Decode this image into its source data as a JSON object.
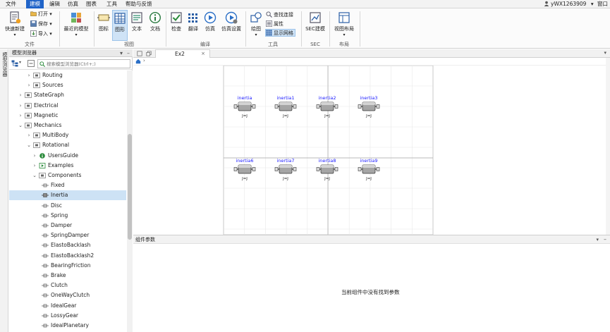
{
  "menubar": {
    "items": [
      "文件",
      "建模",
      "编辑",
      "仿真",
      "图表",
      "工具",
      "帮助与反馈"
    ],
    "active_index": 1,
    "user": "yWX1263909",
    "window_menu": "窗口"
  },
  "ribbon": {
    "file_group": {
      "quick_new": "快速新建",
      "open": "打开",
      "save": "保存",
      "import": "导入",
      "label": "文件"
    },
    "recent_models": "最近的模型",
    "view_group": {
      "icon_view": "图标",
      "diagram_view": "图形",
      "text_view": "文本",
      "doc_view": "文档",
      "label": "视图"
    },
    "compile_group": {
      "check": "检查",
      "translate": "翻译",
      "simulate": "仿真",
      "sim_settings": "仿真设置",
      "label": "编译"
    },
    "tools_group": {
      "draw": "绘图",
      "find_connection": "查找连接",
      "properties": "属性",
      "show_grid": "显示网格",
      "label": "工具"
    },
    "sec_group": {
      "sec_build": "SEC建模",
      "label": "SEC"
    },
    "layout_group": {
      "view_layout": "视图布局",
      "label": "布局"
    }
  },
  "side_strip": {
    "label": "模型浏览器"
  },
  "browser": {
    "title": "模型浏览器",
    "search_placeholder": "搜索模型浏览器(Ctrl+;)",
    "tree": [
      {
        "label": "Routing",
        "level": 2,
        "arrow": ">",
        "icon": "routing-icon"
      },
      {
        "label": "Sources",
        "level": 2,
        "arrow": ">",
        "icon": "sources-icon"
      },
      {
        "label": "StateGraph",
        "level": 1,
        "arrow": ">",
        "icon": "stategraph-icon"
      },
      {
        "label": "Electrical",
        "level": 1,
        "arrow": ">",
        "icon": "electrical-icon"
      },
      {
        "label": "Magnetic",
        "level": 1,
        "arrow": ">",
        "icon": "magnetic-icon"
      },
      {
        "label": "Mechanics",
        "level": 1,
        "arrow": "v",
        "icon": "mechanics-icon"
      },
      {
        "label": "MultiBody",
        "level": 2,
        "arrow": ">",
        "icon": "multibody-icon"
      },
      {
        "label": "Rotational",
        "level": 2,
        "arrow": "v",
        "icon": "rotational-icon"
      },
      {
        "label": "UsersGuide",
        "level": 3,
        "arrow": ">",
        "icon": "info-icon"
      },
      {
        "label": "Examples",
        "level": 3,
        "arrow": ">",
        "icon": "play-icon"
      },
      {
        "label": "Components",
        "level": 3,
        "arrow": "v",
        "icon": "components-icon"
      },
      {
        "label": "Fixed",
        "level": 4,
        "arrow": "",
        "icon": "fixed-icon"
      },
      {
        "label": "Inertia",
        "level": 4,
        "arrow": "",
        "icon": "inertia-icon",
        "selected": true
      },
      {
        "label": "Disc",
        "level": 4,
        "arrow": "",
        "icon": "disc-icon"
      },
      {
        "label": "Spring",
        "level": 4,
        "arrow": "",
        "icon": "spring-icon"
      },
      {
        "label": "Damper",
        "level": 4,
        "arrow": "",
        "icon": "damper-icon"
      },
      {
        "label": "SpringDamper",
        "level": 4,
        "arrow": "",
        "icon": "springdamper-icon"
      },
      {
        "label": "ElastoBacklash",
        "level": 4,
        "arrow": "",
        "icon": "elastobacklash-icon"
      },
      {
        "label": "ElastoBacklash2",
        "level": 4,
        "arrow": "",
        "icon": "elastobacklash2-icon"
      },
      {
        "label": "BearingFriction",
        "level": 4,
        "arrow": "",
        "icon": "bearingfriction-icon"
      },
      {
        "label": "Brake",
        "level": 4,
        "arrow": "",
        "icon": "brake-icon"
      },
      {
        "label": "Clutch",
        "level": 4,
        "arrow": "",
        "icon": "clutch-icon"
      },
      {
        "label": "OneWayClutch",
        "level": 4,
        "arrow": "",
        "icon": "onewayclutch-icon"
      },
      {
        "label": "IdealGear",
        "level": 4,
        "arrow": "",
        "icon": "idealgear-icon"
      },
      {
        "label": "LossyGear",
        "level": 4,
        "arrow": "",
        "icon": "lossygear-icon"
      },
      {
        "label": "IdealPlanetary",
        "level": 4,
        "arrow": "",
        "icon": "idealplanetary-icon"
      }
    ]
  },
  "editor": {
    "tab_label": "Ex2",
    "close_glyph": "×",
    "components": [
      {
        "name": "inertia",
        "param": "J=J"
      },
      {
        "name": "inertia1",
        "param": "J=J"
      },
      {
        "name": "inertia2",
        "param": "J=J"
      },
      {
        "name": "inertia3",
        "param": "J=J"
      },
      {
        "name": "inertia6",
        "param": "J=J"
      },
      {
        "name": "inertia7",
        "param": "J=J"
      },
      {
        "name": "inertia8",
        "param": "J=J"
      },
      {
        "name": "inertia9",
        "param": "J=J"
      }
    ]
  },
  "params": {
    "title": "组件参数",
    "empty_text": "当前组件中没有找到参数"
  },
  "colors": {
    "accent": "#1f63c8",
    "label_blue": "#1a1aff",
    "selection": "#cde2f5"
  }
}
